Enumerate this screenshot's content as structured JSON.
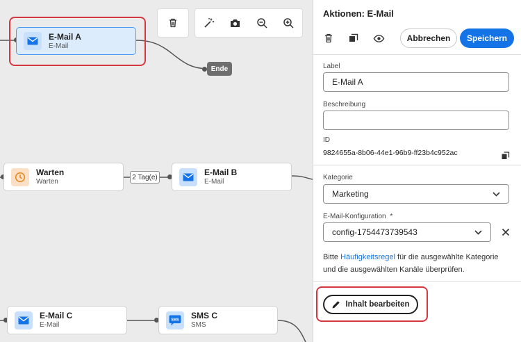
{
  "canvas": {
    "toolbar": {
      "delete_icon": "trash-icon",
      "tools": [
        "magic-wand-icon",
        "camera-icon",
        "zoom-out-icon",
        "zoom-in-icon"
      ]
    },
    "nodes": {
      "email_a": {
        "title": "E-Mail A",
        "subtitle": "E-Mail",
        "icon": "email-icon"
      },
      "warten": {
        "title": "Warten",
        "subtitle": "Warten",
        "icon": "clock-icon"
      },
      "email_b": {
        "title": "E-Mail B",
        "subtitle": "E-Mail",
        "icon": "email-icon"
      },
      "email_c": {
        "title": "E-Mail C",
        "subtitle": "E-Mail",
        "icon": "email-icon"
      },
      "sms_c": {
        "title": "SMS C",
        "subtitle": "SMS",
        "icon": "sms-icon",
        "icon_text": "SMS"
      }
    },
    "end_label": "Ende",
    "wait_label": "2 Tag(e)"
  },
  "panel": {
    "title": "Aktionen: E-Mail",
    "cancel_label": "Abbrechen",
    "save_label": "Speichern",
    "label_field": {
      "label": "Label",
      "value": "E-Mail A"
    },
    "description_field": {
      "label": "Beschreibung",
      "value": ""
    },
    "id_field": {
      "label": "ID",
      "value": "9824655a-8b06-44e1-96b9-ff23b4c952ac"
    },
    "category_field": {
      "label": "Kategorie",
      "value": "Marketing"
    },
    "config_field": {
      "label": "E-Mail-Konfiguration",
      "required_mark": "*",
      "value": "config-1754473739543"
    },
    "hint": {
      "before": "Bitte ",
      "link": "Häufigkeitsregel",
      "after": " für die ausgewählte Kategorie und die ausgewählten Kanäle überprüfen."
    },
    "edit_content_label": "Inhalt bearbeiten"
  },
  "colors": {
    "accent": "#1473e6",
    "highlight": "#d7373f",
    "selected_node_bg": "#dcecfc",
    "canvas_bg": "#ebebeb"
  }
}
